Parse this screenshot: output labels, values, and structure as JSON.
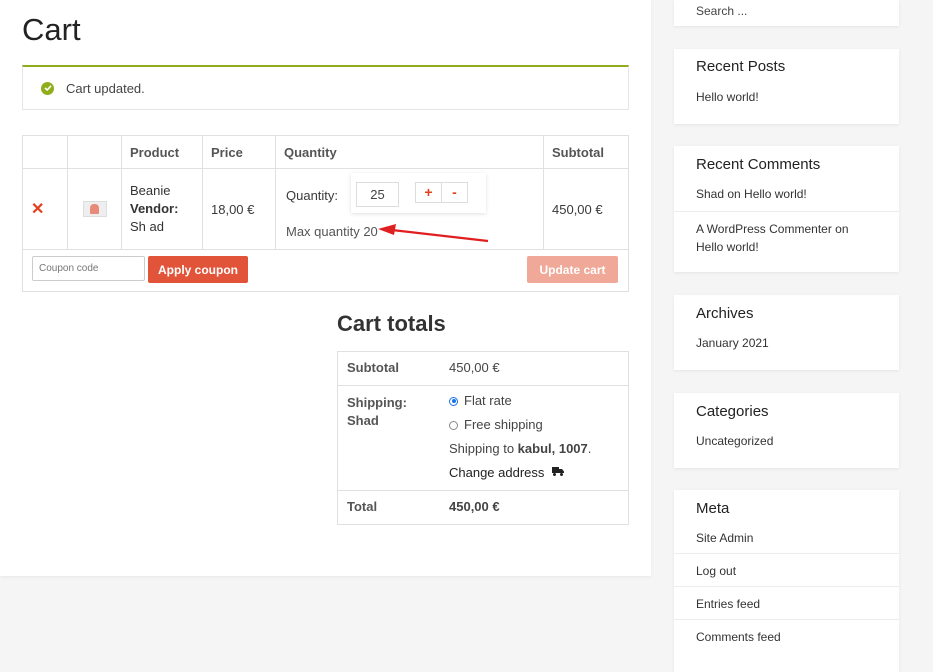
{
  "page": {
    "title": "Cart"
  },
  "notice": {
    "text": "Cart updated."
  },
  "cart_table": {
    "headers": {
      "remove": "",
      "thumb": "",
      "product": "Product",
      "price": "Price",
      "quantity": "Quantity",
      "subtotal": "Subtotal"
    },
    "row": {
      "product_name": "Beanie",
      "vendor_label": "Vendor:",
      "vendor_value": " Sh ad",
      "price": "18,00 €",
      "quantity_label": "Quantity:",
      "quantity_value": "25",
      "plus": "+",
      "minus": "-",
      "max_quantity": "Max quantity 20",
      "subtotal": "450,00 €"
    },
    "coupon_placeholder": "Coupon code",
    "apply_coupon": "Apply coupon",
    "update_cart": "Update cart"
  },
  "totals": {
    "title": "Cart totals",
    "subtotal_label": "Subtotal",
    "subtotal_value": "450,00 €",
    "shipping_label": "Shipping: Shad",
    "shipping_options": [
      "Flat rate",
      "Free shipping"
    ],
    "shipping_to_prefix": "Shipping to ",
    "shipping_to_place": "kabul, 1007",
    "shipping_to_suffix": ".",
    "change_address": "Change address",
    "total_label": "Total",
    "total_value": "450,00 €"
  },
  "sidebar": {
    "search_placeholder": "Search ...",
    "recent_posts": {
      "title": "Recent Posts",
      "items": [
        "Hello world!"
      ]
    },
    "recent_comments": {
      "title": "Recent Comments",
      "items": [
        {
          "author": "Shad",
          "on": " on ",
          "post": "Hello world!"
        },
        {
          "author": "A WordPress Commenter",
          "on": " on ",
          "post": "Hello world!"
        }
      ]
    },
    "archives": {
      "title": "Archives",
      "items": [
        "January 2021"
      ]
    },
    "categories": {
      "title": "Categories",
      "items": [
        "Uncategorized"
      ]
    },
    "meta": {
      "title": "Meta",
      "items": [
        "Site Admin",
        "Log out",
        "Entries feed",
        "Comments feed"
      ]
    }
  },
  "colors": {
    "accent": "#e2543a",
    "notice_border": "#8fae1b",
    "annotation_arrow": "#e02020"
  }
}
